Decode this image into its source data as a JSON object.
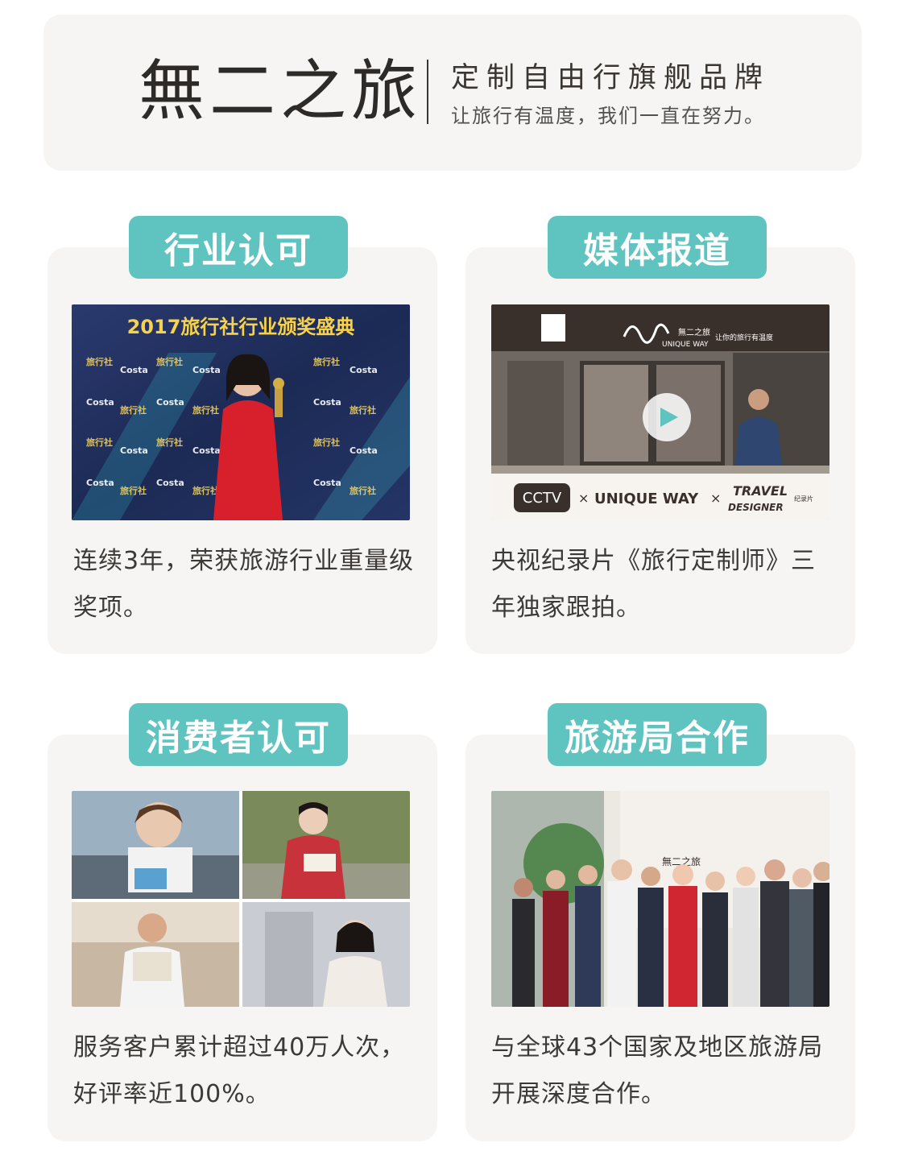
{
  "header": {
    "brand": "無二之旅",
    "tagline": "定制自由行旗舰品牌",
    "slogan": "让旅行有温度，我们一直在努力。"
  },
  "cards": [
    {
      "badge": "行业认可",
      "image": {
        "banner": "2017旅行社行业颁奖盛典",
        "logo_a": "旅行社",
        "logo_b": "Costa"
      },
      "caption": "连续3年，荣获旅游行业重量级奖项。"
    },
    {
      "badge": "媒体报道",
      "image": {
        "sign_cn": "無二之旅",
        "sign_en": "UNIQUE WAY",
        "sign_slogan": "让你的旅行有温度",
        "media": "CCTV",
        "partner": "UNIQUE WAY",
        "program": "TRAVEL",
        "program_2": "DESIGNER",
        "program_tag": "纪录片",
        "cross": "×",
        "play_icon": "play-icon"
      },
      "caption": "央视纪录片《旅行定制师》三年独家跟拍。"
    },
    {
      "badge": "消费者认可",
      "image": {},
      "caption": "服务客户累计超过40万人次，好评率近100%。"
    },
    {
      "badge": "旅游局合作",
      "image": {
        "wall_logo": "無二之旅"
      },
      "caption": "与全球43个国家及地区旅游局开展深度合作。"
    }
  ],
  "colors": {
    "accent": "#5fc3c0",
    "card_bg": "#f6f5f3",
    "text": "#3d3936"
  }
}
